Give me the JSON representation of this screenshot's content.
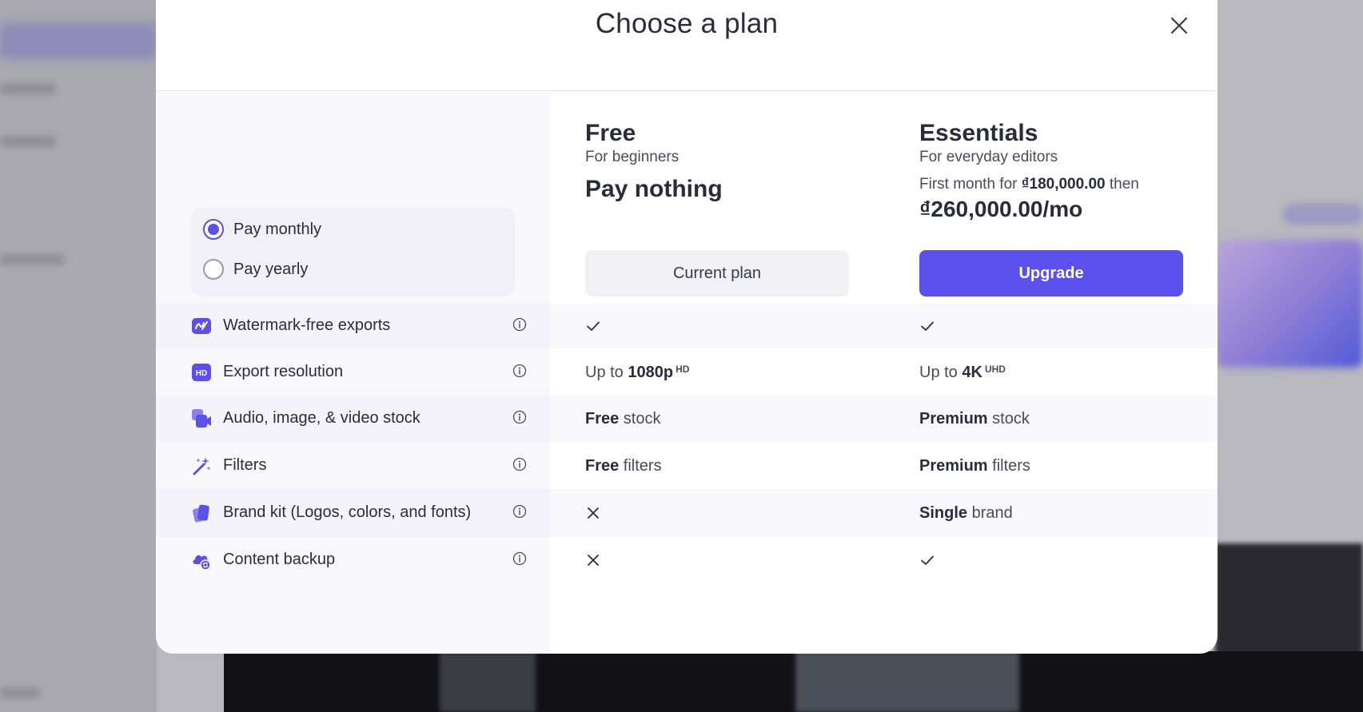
{
  "modal": {
    "title": "Choose a plan",
    "close_icon": "close-icon"
  },
  "billing": {
    "options": [
      {
        "label": "Pay monthly",
        "selected": true
      },
      {
        "label": "Pay yearly",
        "selected": false
      }
    ]
  },
  "plans": {
    "free": {
      "name": "Free",
      "subtitle": "For beginners",
      "price": "Pay nothing",
      "button": "Current plan"
    },
    "essentials": {
      "name": "Essentials",
      "subtitle": "For everyday editors",
      "first_month_prefix": "First month for ",
      "first_month_price": "₫180,000.00",
      "first_month_suffix": " then",
      "price": "₫260,000.00/mo",
      "button": "Upgrade"
    }
  },
  "features": [
    {
      "label": "Watermark-free exports",
      "icon": "watermark-icon",
      "free": {
        "type": "check"
      },
      "essentials": {
        "type": "check"
      }
    },
    {
      "label": "Export resolution",
      "icon": "hd-icon",
      "free": {
        "type": "text",
        "prefix": "Up to ",
        "bold": "1080p",
        "sup": "HD"
      },
      "essentials": {
        "type": "text",
        "prefix": "Up to ",
        "bold": "4K",
        "sup": "UHD"
      }
    },
    {
      "label": "Audio, image, & video stock",
      "icon": "media-stock-icon",
      "free": {
        "type": "text",
        "bold": "Free",
        "suffix": " stock"
      },
      "essentials": {
        "type": "text",
        "bold": "Premium",
        "suffix": " stock"
      }
    },
    {
      "label": "Filters",
      "icon": "magic-wand-icon",
      "free": {
        "type": "text",
        "bold": "Free",
        "suffix": " filters"
      },
      "essentials": {
        "type": "text",
        "bold": "Premium",
        "suffix": " filters"
      }
    },
    {
      "label": "Brand kit (Logos, colors, and fonts)",
      "icon": "brand-kit-icon",
      "free": {
        "type": "cross"
      },
      "essentials": {
        "type": "text",
        "bold": "Single",
        "suffix": " brand"
      }
    },
    {
      "label": "Content backup",
      "icon": "cloud-backup-icon",
      "free": {
        "type": "cross"
      },
      "essentials": {
        "type": "check"
      }
    }
  ],
  "colors": {
    "accent": "#5a50ec",
    "text": "#2b2b3b",
    "muted": "#4a4a5a"
  }
}
